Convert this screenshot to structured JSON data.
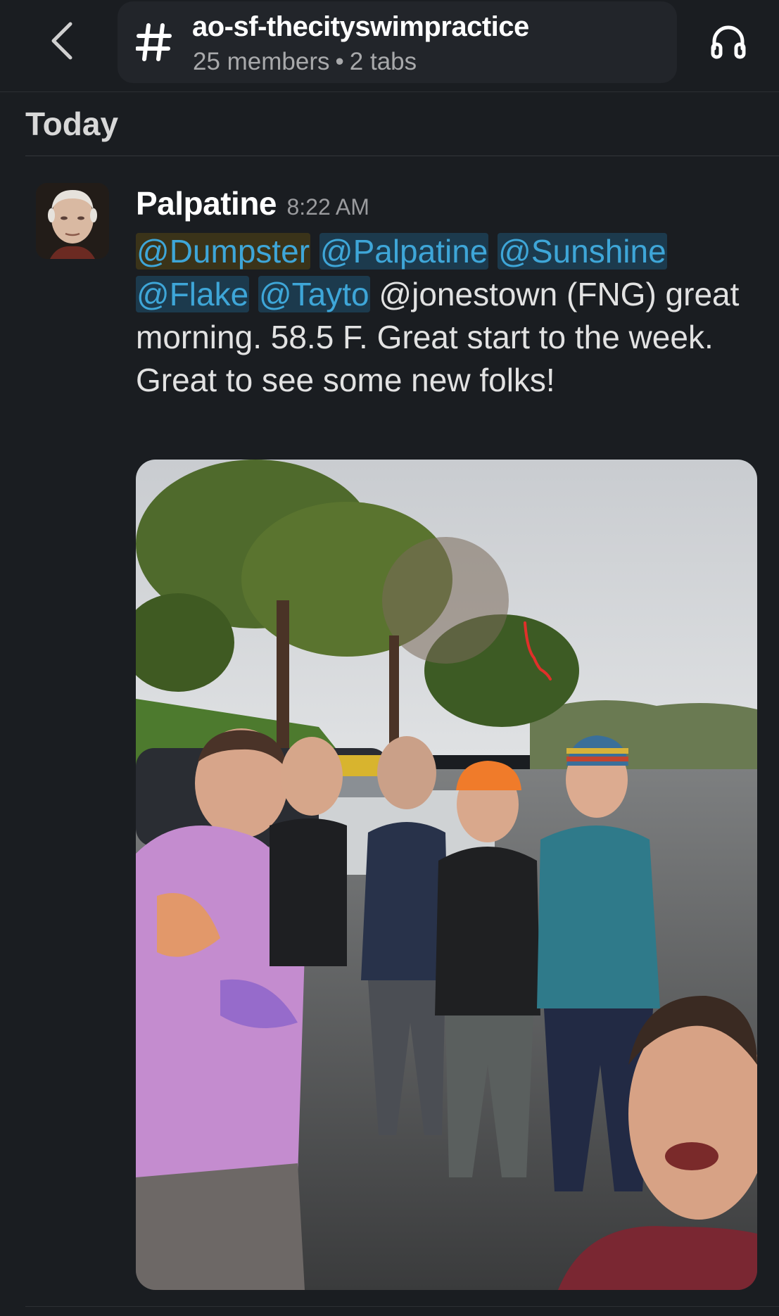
{
  "header": {
    "back_icon": "chevron-left-icon",
    "channel_icon": "hash-icon",
    "channel_name": "ao-sf-thecityswimpractice",
    "member_count": "25 members",
    "separator": "•",
    "tab_count": "2 tabs",
    "huddle_icon": "headphones-icon"
  },
  "day_divider": {
    "label": "Today"
  },
  "message": {
    "sender": "Palpatine",
    "time": "8:22 AM",
    "mentions": {
      "dumpster": "@Dumpster",
      "palpatine": "@Palpatine",
      "sunshine": "@Sunshine",
      "flake": "@Flake",
      "tayto": "@Tayto",
      "jonestown": "@jonestown"
    },
    "text_after_jonestown": " (FNG) great morning.  58.5 F.  Great start to the week.  Great to see some new folks!"
  },
  "colors": {
    "background": "#1a1d21",
    "mention_text": "#3ea6d8",
    "mention_bg": "#1c3a4d",
    "self_mention_bg": "#3a3319"
  }
}
